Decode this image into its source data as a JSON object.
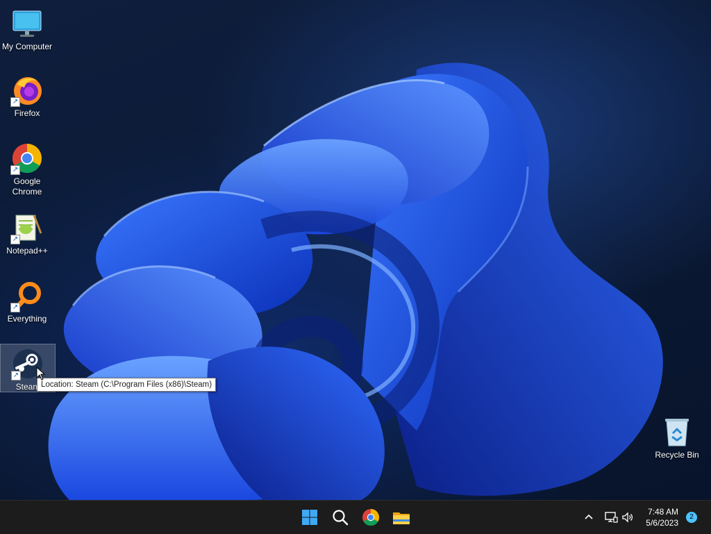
{
  "desktop": {
    "icons": [
      {
        "label": "My Computer",
        "icon": "computer-icon"
      },
      {
        "label": "Firefox",
        "icon": "firefox-icon"
      },
      {
        "label": "Google Chrome",
        "icon": "chrome-icon"
      },
      {
        "label": "Notepad++",
        "icon": "notepadpp-icon"
      },
      {
        "label": "Everything",
        "icon": "everything-search-icon"
      },
      {
        "label": "Steam",
        "icon": "steam-icon"
      },
      {
        "label": "Recycle Bin",
        "icon": "recycle-bin-icon"
      }
    ],
    "tooltip": "Location: Steam (C:\\Program Files (x86)\\Steam)"
  },
  "taskbar": {
    "pinned": [
      {
        "name": "Start",
        "icon": "windows-start-icon"
      },
      {
        "name": "Search",
        "icon": "search-icon"
      },
      {
        "name": "Google Chrome",
        "icon": "chrome-icon"
      },
      {
        "name": "File Explorer",
        "icon": "folder-icon"
      }
    ],
    "tray": {
      "time": "7:48 AM",
      "date": "5/6/2023",
      "notification_count": "2"
    }
  },
  "colors": {
    "accent": "#2a5cff",
    "taskbar_bg": "#1c1c1c",
    "badge": "#4cc2ff"
  }
}
